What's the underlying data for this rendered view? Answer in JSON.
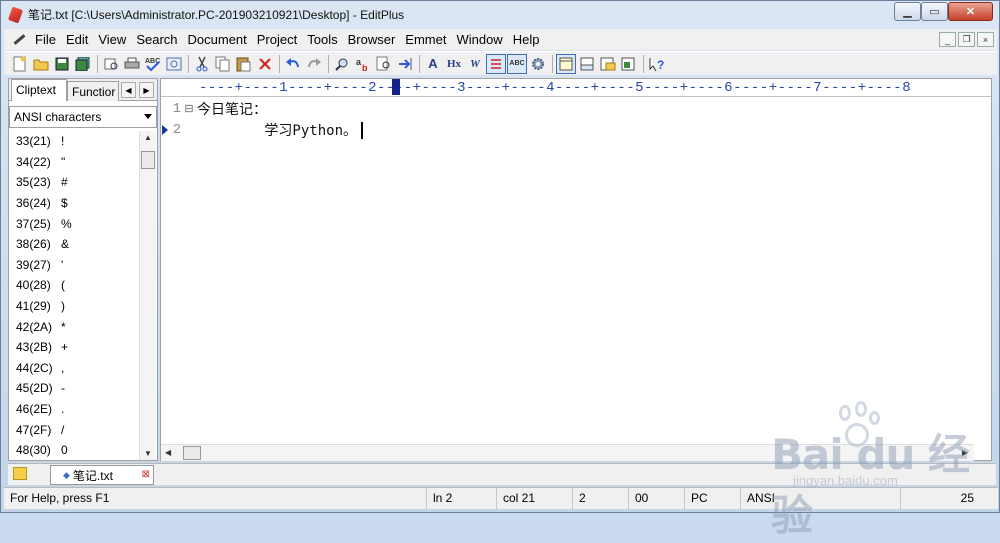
{
  "window": {
    "title": "笔记.txt [C:\\Users\\Administrator.PC-201903210921\\Desktop] - EditPlus"
  },
  "menu": [
    "File",
    "Edit",
    "View",
    "Search",
    "Document",
    "Project",
    "Tools",
    "Browser",
    "Emmet",
    "Window",
    "Help"
  ],
  "toolbar": {
    "icons": [
      "new-file-icon",
      "open-folder-icon",
      "save-icon",
      "save-all-icon",
      "print-preview-icon",
      "print-icon",
      "spellcheck-icon",
      "browser-preview-icon",
      "cut-icon",
      "copy-icon",
      "paste-icon",
      "delete-icon",
      "undo-icon",
      "redo-icon",
      "find-icon",
      "replace-icon",
      "find-in-files-icon",
      "go-to-line-icon",
      "font-icon",
      "hex-viewer-icon",
      "word-wrap-icon",
      "line-number-toggle-icon",
      "column-select-icon",
      "settings-gear-icon",
      "screen-layout-icon",
      "output-window-icon",
      "directory-window-icon",
      "cliptext-window-icon",
      "help-icon"
    ],
    "hx_label": "Hx",
    "w_label": "W",
    "abc_label": "ABC",
    "font_label": "A"
  },
  "left_panel": {
    "tabs": [
      "Cliptext",
      "Functior"
    ],
    "combo_value": "ANSI characters",
    "items": [
      {
        "code": "33(21)",
        "char": "!"
      },
      {
        "code": "34(22)",
        "char": "\""
      },
      {
        "code": "35(23)",
        "char": "#"
      },
      {
        "code": "36(24)",
        "char": "$"
      },
      {
        "code": "37(25)",
        "char": "%"
      },
      {
        "code": "38(26)",
        "char": "&"
      },
      {
        "code": "39(27)",
        "char": "'"
      },
      {
        "code": "40(28)",
        "char": "("
      },
      {
        "code": "41(29)",
        "char": ")"
      },
      {
        "code": "42(2A)",
        "char": "*"
      },
      {
        "code": "43(2B)",
        "char": "+"
      },
      {
        "code": "44(2C)",
        "char": ","
      },
      {
        "code": "45(2D)",
        "char": "-"
      },
      {
        "code": "46(2E)",
        "char": "."
      },
      {
        "code": "47(2F)",
        "char": "/"
      },
      {
        "code": "48(30)",
        "char": "0"
      }
    ]
  },
  "editor": {
    "ruler": "----+----1----+----2----+----3----+----4----+----5----+----6----+----7----+----8",
    "lines": [
      {
        "num": "1",
        "fold": "⊟",
        "text": "今日笔记："
      },
      {
        "num": "2",
        "fold": "",
        "text": "        学习Python。"
      }
    ]
  },
  "doc_tabs": [
    {
      "label": "笔记.txt"
    }
  ],
  "status": {
    "help": "For Help, press F1",
    "ln": "ln 2",
    "col": "col 21",
    "v1": "2",
    "v2": "00",
    "eol": "PC",
    "enc": "ANSI",
    "right": "25"
  },
  "watermark": {
    "brand": "Bai du 经验",
    "url": "jingyan.baidu.com"
  }
}
